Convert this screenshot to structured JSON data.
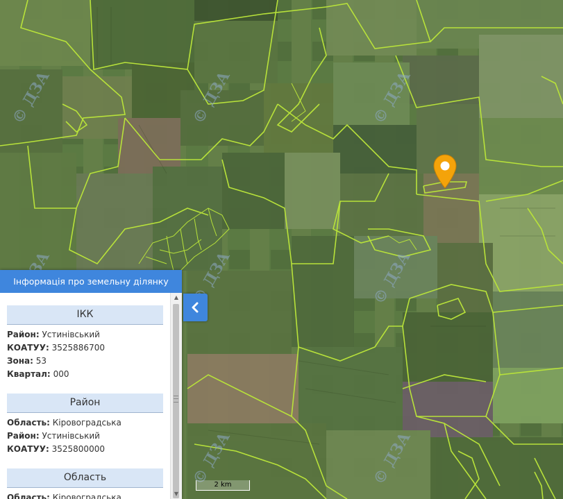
{
  "map": {
    "watermark": "© ДЗА",
    "scale_label": "2 km",
    "boundary_color": "#b8e23a",
    "marker_color": "#f4a30a",
    "marker_icon": "map-pin-icon"
  },
  "panel": {
    "header": "Інформація про земельну ділянку",
    "collapse_icon": "chevron-left-icon",
    "sections": {
      "ikk": {
        "title": "ІКК",
        "rows": [
          {
            "key": "Район:",
            "value": "Устинівський"
          },
          {
            "key": "КОАТУУ:",
            "value": "3525886700"
          },
          {
            "key": "Зона:",
            "value": "53"
          },
          {
            "key": "Квартал:",
            "value": "000"
          }
        ]
      },
      "rayon": {
        "title": "Район",
        "rows": [
          {
            "key": "Область:",
            "value": "Кіровоградська"
          },
          {
            "key": "Район:",
            "value": "Устинівський"
          },
          {
            "key": "КОАТУУ:",
            "value": "3525800000"
          }
        ]
      },
      "oblast": {
        "title": "Область",
        "rows": [
          {
            "key": "Область:",
            "value": "Кіровоградська"
          }
        ]
      }
    }
  },
  "colors": {
    "header_bg": "#3f86dd",
    "section_bg": "#d9e6f6"
  }
}
